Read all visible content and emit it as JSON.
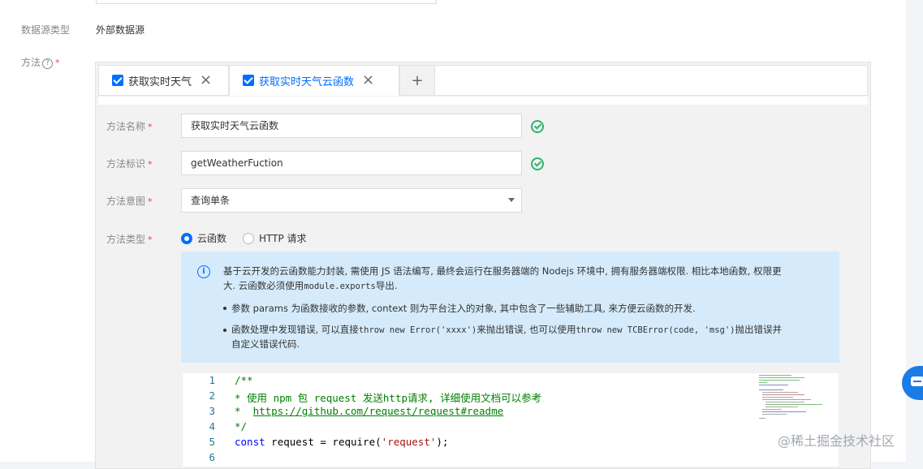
{
  "form": {
    "datasource_type_label": "数据源类型",
    "datasource_type_value": "外部数据源",
    "method_label": "方法",
    "help_glyph": "?",
    "required_mark": "*"
  },
  "tabs": [
    {
      "label": "获取实时天气",
      "checked": true,
      "active": false
    },
    {
      "label": "获取实时天气云函数",
      "checked": true,
      "active": true
    }
  ],
  "tab_close_glyph": "×",
  "add_tab_glyph": "+",
  "method_form": {
    "name_label": "方法名称",
    "name_value": "获取实时天气云函数",
    "id_label": "方法标识",
    "id_value": "getWeatherFuction",
    "intent_label": "方法意图",
    "intent_value": "查询单条",
    "type_label": "方法类型",
    "type_options": [
      "云函数",
      "HTTP 请求"
    ],
    "type_selected": "云函数"
  },
  "info_box": {
    "icon_glyph": "i",
    "line1": "基于云开发的云函数能力封装, 需使用 JS 语法编写, 最终会运行在服务器端的 Nodejs 环境中, 拥有服务器端权限. 相比本地函数, 权限更",
    "line2_a": "大. 云函数必须使用",
    "line2_code": "module.exports",
    "line2_b": "导出.",
    "bullet1": "参数 params 为函数接收的参数, context 则为平台注入的对象, 其中包含了一些辅助工具, 来方便云函数的开发.",
    "bullet2_a": "函数处理中发现错误, 可以直接",
    "bullet2_code1": "throw new Error('xxxx')",
    "bullet2_b": "来抛出错误, 也可以使用",
    "bullet2_code2": "throw new TCBError(code, 'msg')",
    "bullet2_c": "抛出错误并",
    "bullet2_line2": "自定义错误代码."
  },
  "editor": {
    "line_numbers": [
      "1",
      "2",
      "3",
      "4",
      "5",
      "6"
    ],
    "line1": "/**",
    "line2": "* 使用 npm 包 request 发送http请求, 详细使用文档可以参考",
    "line3_prefix": "*  ",
    "line3_link": "https://github.com/request/request#readme",
    "line4": "*/",
    "line5_kw": "const",
    "line5_a": " request = require(",
    "line5_str": "'request'",
    "line5_b": ");"
  },
  "watermark": "@稀土掘金技术社区",
  "colors": {
    "accent": "#006eff",
    "success": "#2fb36d",
    "required": "#e54545",
    "info_bg": "#d5ebfc",
    "comment": "#008000",
    "keyword": "#0000ff",
    "string": "#a31515",
    "chat_button": "#1c7ce6"
  },
  "icons": [
    "check-circle-icon",
    "info-icon",
    "chat-icon",
    "close-icon",
    "plus-icon",
    "caret-down-icon",
    "help-icon"
  ]
}
